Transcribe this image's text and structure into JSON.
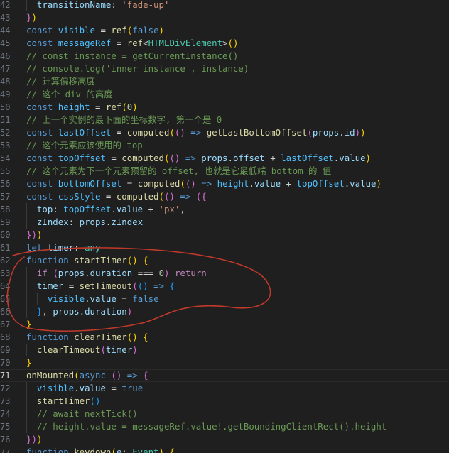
{
  "editor": {
    "active_line": 71,
    "annotation_color": "#c0392b",
    "lines": [
      {
        "n": "42",
        "t": [
          [
            "  ",
            "pun"
          ],
          [
            "transitionName",
            "var"
          ],
          [
            ": ",
            "pun"
          ],
          [
            "'fade-up'",
            "str"
          ]
        ]
      },
      {
        "n": "43",
        "t": [
          [
            "}",
            "b2"
          ],
          [
            ")",
            "b1"
          ]
        ]
      },
      {
        "n": "44",
        "t": [
          [
            "const ",
            "kw"
          ],
          [
            "visible",
            "cn"
          ],
          [
            " = ",
            "pun"
          ],
          [
            "ref",
            "fn"
          ],
          [
            "(",
            "b1"
          ],
          [
            "false",
            "kw"
          ],
          [
            ")",
            "b1"
          ]
        ]
      },
      {
        "n": "45",
        "t": [
          [
            "const ",
            "kw"
          ],
          [
            "messageRef",
            "cn"
          ],
          [
            " = ",
            "pun"
          ],
          [
            "ref",
            "fn"
          ],
          [
            "<",
            "pun"
          ],
          [
            "HTMLDivElement",
            "ty"
          ],
          [
            ">",
            "pun"
          ],
          [
            "()",
            "b1"
          ]
        ]
      },
      {
        "n": "46",
        "t": [
          [
            "// const instance = getCurrentInstance()",
            "cmt"
          ]
        ]
      },
      {
        "n": "47",
        "t": [
          [
            "// console.log('inner instance', instance)",
            "cmt"
          ]
        ]
      },
      {
        "n": "48",
        "t": [
          [
            "// 计算偏移高度",
            "cmt"
          ]
        ]
      },
      {
        "n": "49",
        "t": [
          [
            "// 这个 div 的高度",
            "cmt"
          ]
        ]
      },
      {
        "n": "50",
        "t": [
          [
            "const ",
            "kw"
          ],
          [
            "height",
            "cn"
          ],
          [
            " = ",
            "pun"
          ],
          [
            "ref",
            "fn"
          ],
          [
            "(",
            "b1"
          ],
          [
            "0",
            "num"
          ],
          [
            ")",
            "b1"
          ]
        ]
      },
      {
        "n": "51",
        "t": [
          [
            "// 上一个实例的最下面的坐标数字, 第一个是 0",
            "cmt"
          ]
        ]
      },
      {
        "n": "52",
        "t": [
          [
            "const ",
            "kw"
          ],
          [
            "lastOffset",
            "cn"
          ],
          [
            " = ",
            "pun"
          ],
          [
            "computed",
            "fn"
          ],
          [
            "(",
            "b1"
          ],
          [
            "()",
            "b2"
          ],
          [
            " => ",
            "kw"
          ],
          [
            "getLastBottomOffset",
            "fn"
          ],
          [
            "(",
            "b2"
          ],
          [
            "props",
            "var"
          ],
          [
            ".",
            "pun"
          ],
          [
            "id",
            "var"
          ],
          [
            ")",
            "b2"
          ],
          [
            ")",
            "b1"
          ]
        ]
      },
      {
        "n": "53",
        "t": [
          [
            "// 这个元素应该使用的 top",
            "cmt"
          ]
        ]
      },
      {
        "n": "54",
        "t": [
          [
            "const ",
            "kw"
          ],
          [
            "topOffset",
            "cn"
          ],
          [
            " = ",
            "pun"
          ],
          [
            "computed",
            "fn"
          ],
          [
            "(",
            "b1"
          ],
          [
            "()",
            "b2"
          ],
          [
            " => ",
            "kw"
          ],
          [
            "props",
            "var"
          ],
          [
            ".",
            "pun"
          ],
          [
            "offset",
            "var"
          ],
          [
            " + ",
            "pun"
          ],
          [
            "lastOffset",
            "cn"
          ],
          [
            ".",
            "pun"
          ],
          [
            "value",
            "var"
          ],
          [
            ")",
            "b1"
          ]
        ]
      },
      {
        "n": "55",
        "t": [
          [
            "// 这个元素为下一个元素预留的 offset, 也就是它最低端 bottom 的 值",
            "cmt"
          ]
        ]
      },
      {
        "n": "56",
        "t": [
          [
            "const ",
            "kw"
          ],
          [
            "bottomOffset",
            "cn"
          ],
          [
            " = ",
            "pun"
          ],
          [
            "computed",
            "fn"
          ],
          [
            "(",
            "b1"
          ],
          [
            "()",
            "b2"
          ],
          [
            " => ",
            "kw"
          ],
          [
            "height",
            "cn"
          ],
          [
            ".",
            "pun"
          ],
          [
            "value",
            "var"
          ],
          [
            " + ",
            "pun"
          ],
          [
            "topOffset",
            "cn"
          ],
          [
            ".",
            "pun"
          ],
          [
            "value",
            "var"
          ],
          [
            ")",
            "b1"
          ]
        ]
      },
      {
        "n": "57",
        "t": [
          [
            "const ",
            "kw"
          ],
          [
            "cssStyle",
            "cn"
          ],
          [
            " = ",
            "pun"
          ],
          [
            "computed",
            "fn"
          ],
          [
            "(",
            "b1"
          ],
          [
            "()",
            "b2"
          ],
          [
            " => ",
            "kw"
          ],
          [
            "({",
            "b2"
          ]
        ]
      },
      {
        "n": "58",
        "t": [
          [
            "  ",
            "pun"
          ],
          [
            "top",
            "var"
          ],
          [
            ": ",
            "pun"
          ],
          [
            "topOffset",
            "cn"
          ],
          [
            ".",
            "pun"
          ],
          [
            "value",
            "var"
          ],
          [
            " + ",
            "pun"
          ],
          [
            "'px'",
            "str"
          ],
          [
            ",",
            "pun"
          ]
        ]
      },
      {
        "n": "59",
        "t": [
          [
            "  ",
            "pun"
          ],
          [
            "zIndex",
            "var"
          ],
          [
            ": ",
            "pun"
          ],
          [
            "props",
            "var"
          ],
          [
            ".",
            "pun"
          ],
          [
            "zIndex",
            "var"
          ]
        ]
      },
      {
        "n": "60",
        "t": [
          [
            "})",
            "b2"
          ],
          [
            ")",
            "b1"
          ]
        ]
      },
      {
        "n": "61",
        "t": [
          [
            "let ",
            "kw"
          ],
          [
            "timer",
            "var"
          ],
          [
            ": ",
            "pun"
          ],
          [
            "any",
            "ty"
          ]
        ]
      },
      {
        "n": "62",
        "t": [
          [
            "function ",
            "kw"
          ],
          [
            "startTimer",
            "fn"
          ],
          [
            "()",
            "b1"
          ],
          [
            " ",
            "pun"
          ],
          [
            "{",
            "b1"
          ]
        ]
      },
      {
        "n": "63",
        "t": [
          [
            "  ",
            "pun"
          ],
          [
            "if ",
            "ctl"
          ],
          [
            "(",
            "b2"
          ],
          [
            "props",
            "var"
          ],
          [
            ".",
            "pun"
          ],
          [
            "duration",
            "var"
          ],
          [
            " === ",
            "pun"
          ],
          [
            "0",
            "num"
          ],
          [
            ")",
            "b2"
          ],
          [
            " return",
            "ctl"
          ]
        ]
      },
      {
        "n": "64",
        "t": [
          [
            "  ",
            "pun"
          ],
          [
            "timer",
            "var"
          ],
          [
            " = ",
            "pun"
          ],
          [
            "setTimeout",
            "fn"
          ],
          [
            "(",
            "b2"
          ],
          [
            "()",
            "b3"
          ],
          [
            " => ",
            "kw"
          ],
          [
            "{",
            "b3"
          ]
        ]
      },
      {
        "n": "65",
        "t": [
          [
            "    ",
            "pun"
          ],
          [
            "visible",
            "cn"
          ],
          [
            ".",
            "pun"
          ],
          [
            "value",
            "var"
          ],
          [
            " = ",
            "pun"
          ],
          [
            "false",
            "kw"
          ]
        ]
      },
      {
        "n": "66",
        "t": [
          [
            "  ",
            "pun"
          ],
          [
            "}",
            "b3"
          ],
          [
            ", ",
            "pun"
          ],
          [
            "props",
            "var"
          ],
          [
            ".",
            "pun"
          ],
          [
            "duration",
            "var"
          ],
          [
            ")",
            "b2"
          ]
        ]
      },
      {
        "n": "67",
        "t": [
          [
            "}",
            "b1"
          ]
        ]
      },
      {
        "n": "68",
        "t": [
          [
            "function ",
            "kw"
          ],
          [
            "clearTimer",
            "fn"
          ],
          [
            "()",
            "b1"
          ],
          [
            " ",
            "pun"
          ],
          [
            "{",
            "b1"
          ]
        ]
      },
      {
        "n": "69",
        "t": [
          [
            "  ",
            "pun"
          ],
          [
            "clearTimeout",
            "fn"
          ],
          [
            "(",
            "b2"
          ],
          [
            "timer",
            "var"
          ],
          [
            ")",
            "b2"
          ]
        ]
      },
      {
        "n": "70",
        "t": [
          [
            "}",
            "b1"
          ]
        ]
      },
      {
        "n": "71",
        "t": [
          [
            "onMounted",
            "fn"
          ],
          [
            "(",
            "b1"
          ],
          [
            "async ",
            "kw"
          ],
          [
            "()",
            "b2"
          ],
          [
            " => ",
            "kw"
          ],
          [
            "{",
            "b2"
          ]
        ]
      },
      {
        "n": "72",
        "t": [
          [
            "  ",
            "pun"
          ],
          [
            "visible",
            "cn"
          ],
          [
            ".",
            "pun"
          ],
          [
            "value",
            "var"
          ],
          [
            " = ",
            "pun"
          ],
          [
            "true",
            "kw"
          ]
        ]
      },
      {
        "n": "73",
        "t": [
          [
            "  ",
            "pun"
          ],
          [
            "startTimer",
            "fn"
          ],
          [
            "()",
            "b3"
          ]
        ]
      },
      {
        "n": "74",
        "t": [
          [
            "  ",
            "pun"
          ],
          [
            "// await nextTick()",
            "cmt"
          ]
        ]
      },
      {
        "n": "75",
        "t": [
          [
            "  ",
            "pun"
          ],
          [
            "// height.value = messageRef.value!.getBoundingClientRect().height",
            "cmt"
          ]
        ]
      },
      {
        "n": "76",
        "t": [
          [
            "})",
            "b2"
          ],
          [
            ")",
            "b1"
          ]
        ]
      },
      {
        "n": "77",
        "t": [
          [
            "function ",
            "kw"
          ],
          [
            "keydown",
            "fn"
          ],
          [
            "(",
            "b1"
          ],
          [
            "e",
            "var"
          ],
          [
            ": ",
            "pun"
          ],
          [
            "Event",
            "ty"
          ],
          [
            ") ",
            "b1"
          ],
          [
            "{",
            "b1"
          ]
        ]
      }
    ]
  }
}
